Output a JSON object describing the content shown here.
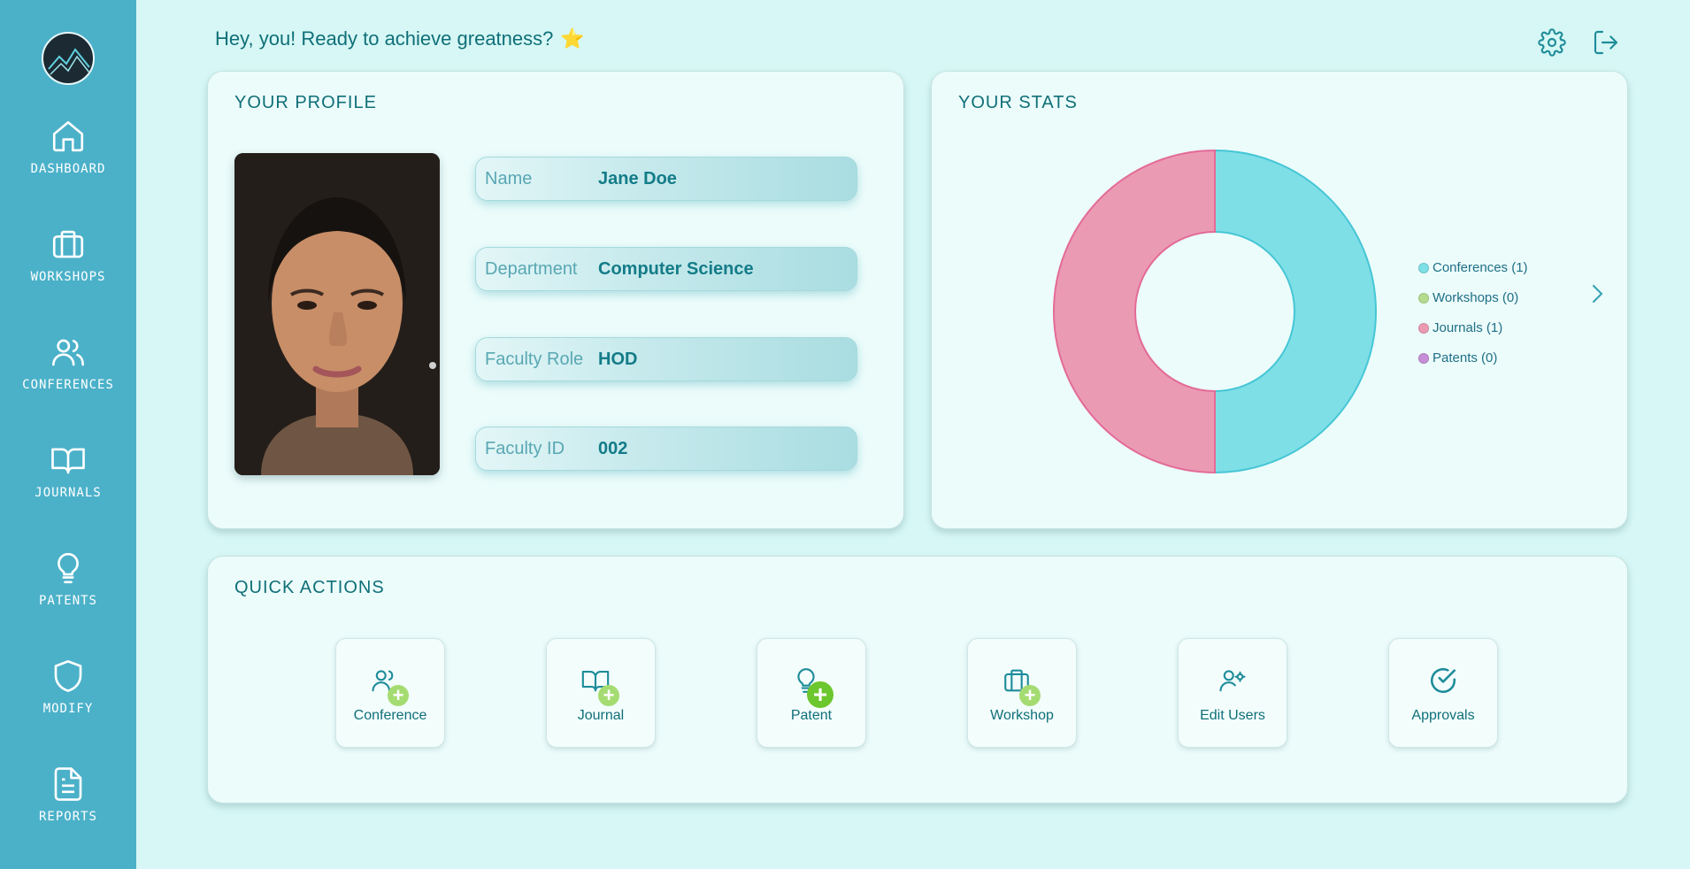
{
  "greeting": {
    "text": "Hey, you! Ready to achieve greatness?",
    "emoji": "⭐"
  },
  "nav": [
    {
      "label": "DASHBOARD",
      "icon": "home-icon"
    },
    {
      "label": "WORKSHOPS",
      "icon": "briefcase-icon"
    },
    {
      "label": "CONFERENCES",
      "icon": "users-icon"
    },
    {
      "label": "JOURNALS",
      "icon": "book-icon"
    },
    {
      "label": "PATENTS",
      "icon": "lightbulb-icon"
    },
    {
      "label": "MODIFY",
      "icon": "shield-icon"
    },
    {
      "label": "REPORTS",
      "icon": "document-icon"
    }
  ],
  "header": {
    "settings_icon": "gear-icon",
    "logout_icon": "logout-icon"
  },
  "profile": {
    "title": "YOUR PROFILE",
    "fields": [
      {
        "label": "Name",
        "value": "Jane Doe"
      },
      {
        "label": "Department",
        "value": "Computer Science"
      },
      {
        "label": "Faculty Role",
        "value": "HOD"
      },
      {
        "label": "Faculty ID",
        "value": "002"
      }
    ]
  },
  "stats": {
    "title": "YOUR STATS"
  },
  "chart_data": {
    "type": "pie",
    "style": "donut",
    "categories": [
      "Conferences",
      "Workshops",
      "Journals",
      "Patents"
    ],
    "values": [
      1,
      0,
      1,
      0
    ],
    "legend": [
      "Conferences (1)",
      "Workshops (0)",
      "Journals (1)",
      "Patents (0)"
    ],
    "colors": [
      "#7fdfe6",
      "#b5dc8e",
      "#eb9ab4",
      "#c68ed6"
    ],
    "legend_position": "right"
  },
  "quick_actions": {
    "title": "QUICK ACTIONS",
    "items": [
      {
        "label": "Conference",
        "icon": "users-plus-icon"
      },
      {
        "label": "Journal",
        "icon": "book-plus-icon"
      },
      {
        "label": "Patent",
        "icon": "lightbulb-plus-icon"
      },
      {
        "label": "Workshop",
        "icon": "briefcase-plus-icon"
      },
      {
        "label": "Edit Users",
        "icon": "user-gear-icon"
      },
      {
        "label": "Approvals",
        "icon": "check-circle-icon"
      }
    ]
  },
  "colors": {
    "sidebar": "#4bb1c9",
    "background": "#d6f7f5",
    "accent": "#0f6f78",
    "plus": "#a5dc72"
  }
}
